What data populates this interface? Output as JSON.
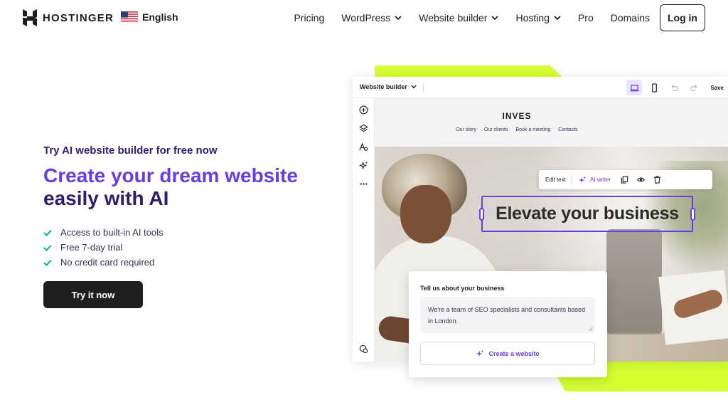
{
  "colors": {
    "brand_purple": "#673de6",
    "dark_navy": "#2f1c6a",
    "lime": "#d5fe33",
    "check_green": "#00b090",
    "button_dark": "#1d1e20"
  },
  "header": {
    "logo_text": "HOSTINGER",
    "logo_icon": "hostinger-logo-icon",
    "language": {
      "label": "English",
      "flag_icon": "us-flag-icon"
    },
    "nav": [
      {
        "label": "Pricing",
        "has_dropdown": false
      },
      {
        "label": "WordPress",
        "has_dropdown": true
      },
      {
        "label": "Website builder",
        "has_dropdown": true
      },
      {
        "label": "Hosting",
        "has_dropdown": true
      },
      {
        "label": "Pro",
        "has_dropdown": false
      },
      {
        "label": "Domains",
        "has_dropdown": false
      }
    ],
    "login_label": "Log in"
  },
  "hero": {
    "kicker": "Try AI website builder for free now",
    "title_accent": "Create your dream website",
    "title_rest": " easily with AI",
    "features": [
      "Access to built-in AI tools",
      "Free 7-day trial",
      "No credit card required"
    ],
    "cta_label": "Try it now"
  },
  "builder": {
    "dropdown_label": "Website builder",
    "save_label": "Save",
    "toolbar_icons": [
      "desktop-icon",
      "mobile-icon",
      "undo-icon",
      "redo-icon"
    ],
    "sidebar_icons": [
      "add-icon",
      "layers-icon",
      "typography-icon",
      "ai-sparkle-icon",
      "more-icon",
      "ai-assistant-icon"
    ],
    "site": {
      "brand": "INVES",
      "nav": [
        "Our story",
        "Our clients",
        "Book a meeting",
        "Contacts"
      ],
      "headline": "Elevate your business"
    },
    "edit_toolbar": {
      "edit_text_label": "Edit text",
      "ai_writer_label": "AI writer",
      "icons": [
        "duplicate-icon",
        "visibility-icon",
        "delete-icon"
      ]
    }
  },
  "prompt_card": {
    "title": "Tell us about your business",
    "textarea_value": "We're a team of SEO specialists and consultants based in London.",
    "button_label": "Create a website"
  }
}
